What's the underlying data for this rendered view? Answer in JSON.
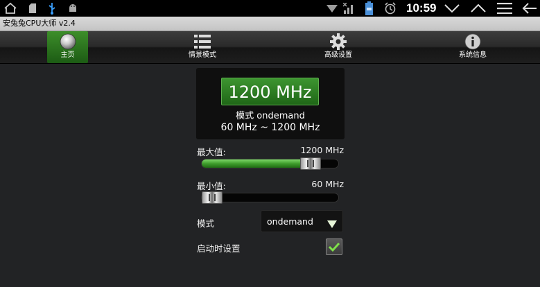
{
  "status_bar": {
    "time": "10:59",
    "left_icons": [
      "home-outline-icon",
      "sd-card-icon",
      "usb-icon",
      "android-debug-icon"
    ],
    "right_icons": [
      "wifi-icon",
      "signal-icon",
      "battery-icon",
      "alarm-icon"
    ],
    "nav_icons": [
      "collapse-down-icon",
      "expand-up-icon",
      "menu-icon",
      "back-icon"
    ]
  },
  "app": {
    "title": "安兔兔CPU大师 v2.4"
  },
  "tabs": [
    {
      "label": "主页",
      "icon": "home-orb-icon",
      "active": true
    },
    {
      "label": "情景模式",
      "icon": "list-icon",
      "active": false
    },
    {
      "label": "高级设置",
      "icon": "gear-icon",
      "active": false
    },
    {
      "label": "系统信息",
      "icon": "info-icon",
      "active": false
    }
  ],
  "main": {
    "current_freq": "1200 MHz",
    "mode_line": "模式 ondemand",
    "range_line": "60 MHz ~ 1200 MHz",
    "max": {
      "label": "最大值:",
      "value": "1200 MHz",
      "fraction": 0.85
    },
    "min": {
      "label": "最小值:",
      "value": "60 MHz",
      "fraction": 0.0
    },
    "governor": {
      "label": "模式",
      "selected": "ondemand"
    },
    "set_on_boot": {
      "label": "启动时设置",
      "checked": true
    }
  },
  "colors": {
    "accent_green": "#3d9530",
    "background": "#222325"
  }
}
